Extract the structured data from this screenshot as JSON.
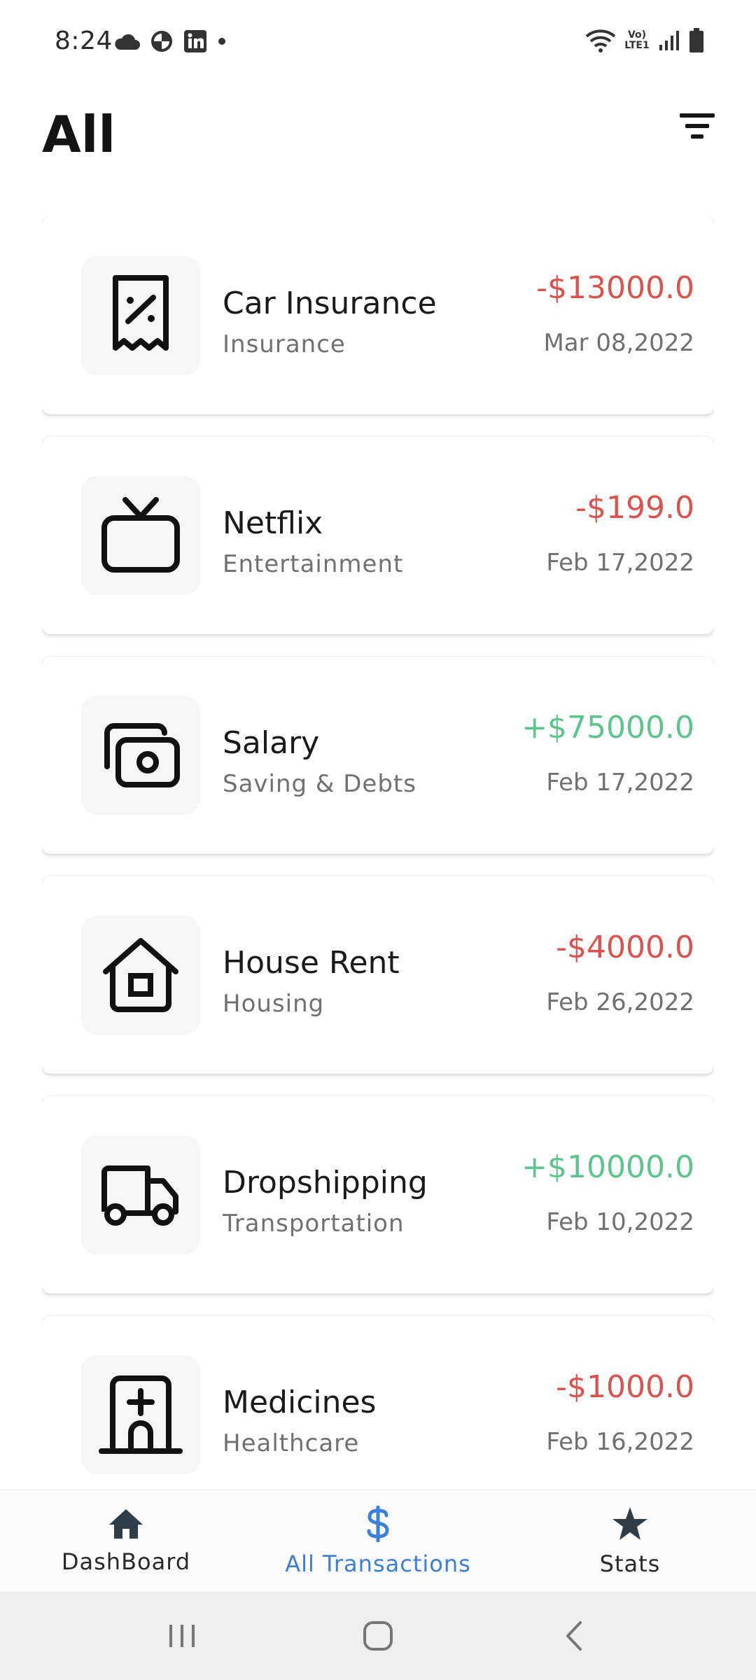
{
  "status_bar": {
    "time": "8:24",
    "network_label": "Vo) LTE1"
  },
  "header": {
    "title": "All"
  },
  "transactions": [
    {
      "title": "Car Insurance",
      "category": "Insurance",
      "amount": "-$13000.0",
      "date": "Mar 08,2022",
      "type": "expense",
      "icon": "receipt-percent-icon"
    },
    {
      "title": "Netflix",
      "category": "Entertainment",
      "amount": "-$199.0",
      "date": "Feb 17,2022",
      "type": "expense",
      "icon": "tv-icon"
    },
    {
      "title": "Salary",
      "category": "Saving & Debts",
      "amount": "+$75000.0",
      "date": "Feb 17,2022",
      "type": "income",
      "icon": "cash-icon"
    },
    {
      "title": "House Rent",
      "category": "Housing",
      "amount": "-$4000.0",
      "date": "Feb 26,2022",
      "type": "expense",
      "icon": "house-icon"
    },
    {
      "title": "Dropshipping",
      "category": "Transportation",
      "amount": "+$10000.0",
      "date": "Feb 10,2022",
      "type": "income",
      "icon": "truck-icon"
    },
    {
      "title": "Medicines",
      "category": "Healthcare",
      "amount": "-$1000.0",
      "date": "Feb 16,2022",
      "type": "expense",
      "icon": "hospital-icon"
    }
  ],
  "bottom_nav": {
    "items": [
      {
        "label": "DashBoard",
        "icon": "home-icon",
        "active": false
      },
      {
        "label": "All Transactions",
        "icon": "dollar-icon",
        "active": true
      },
      {
        "label": "Stats",
        "icon": "star-icon",
        "active": false
      }
    ]
  },
  "colors": {
    "expense": "#d9534f",
    "income": "#5ec48e",
    "active_nav": "#3b7fd6"
  }
}
